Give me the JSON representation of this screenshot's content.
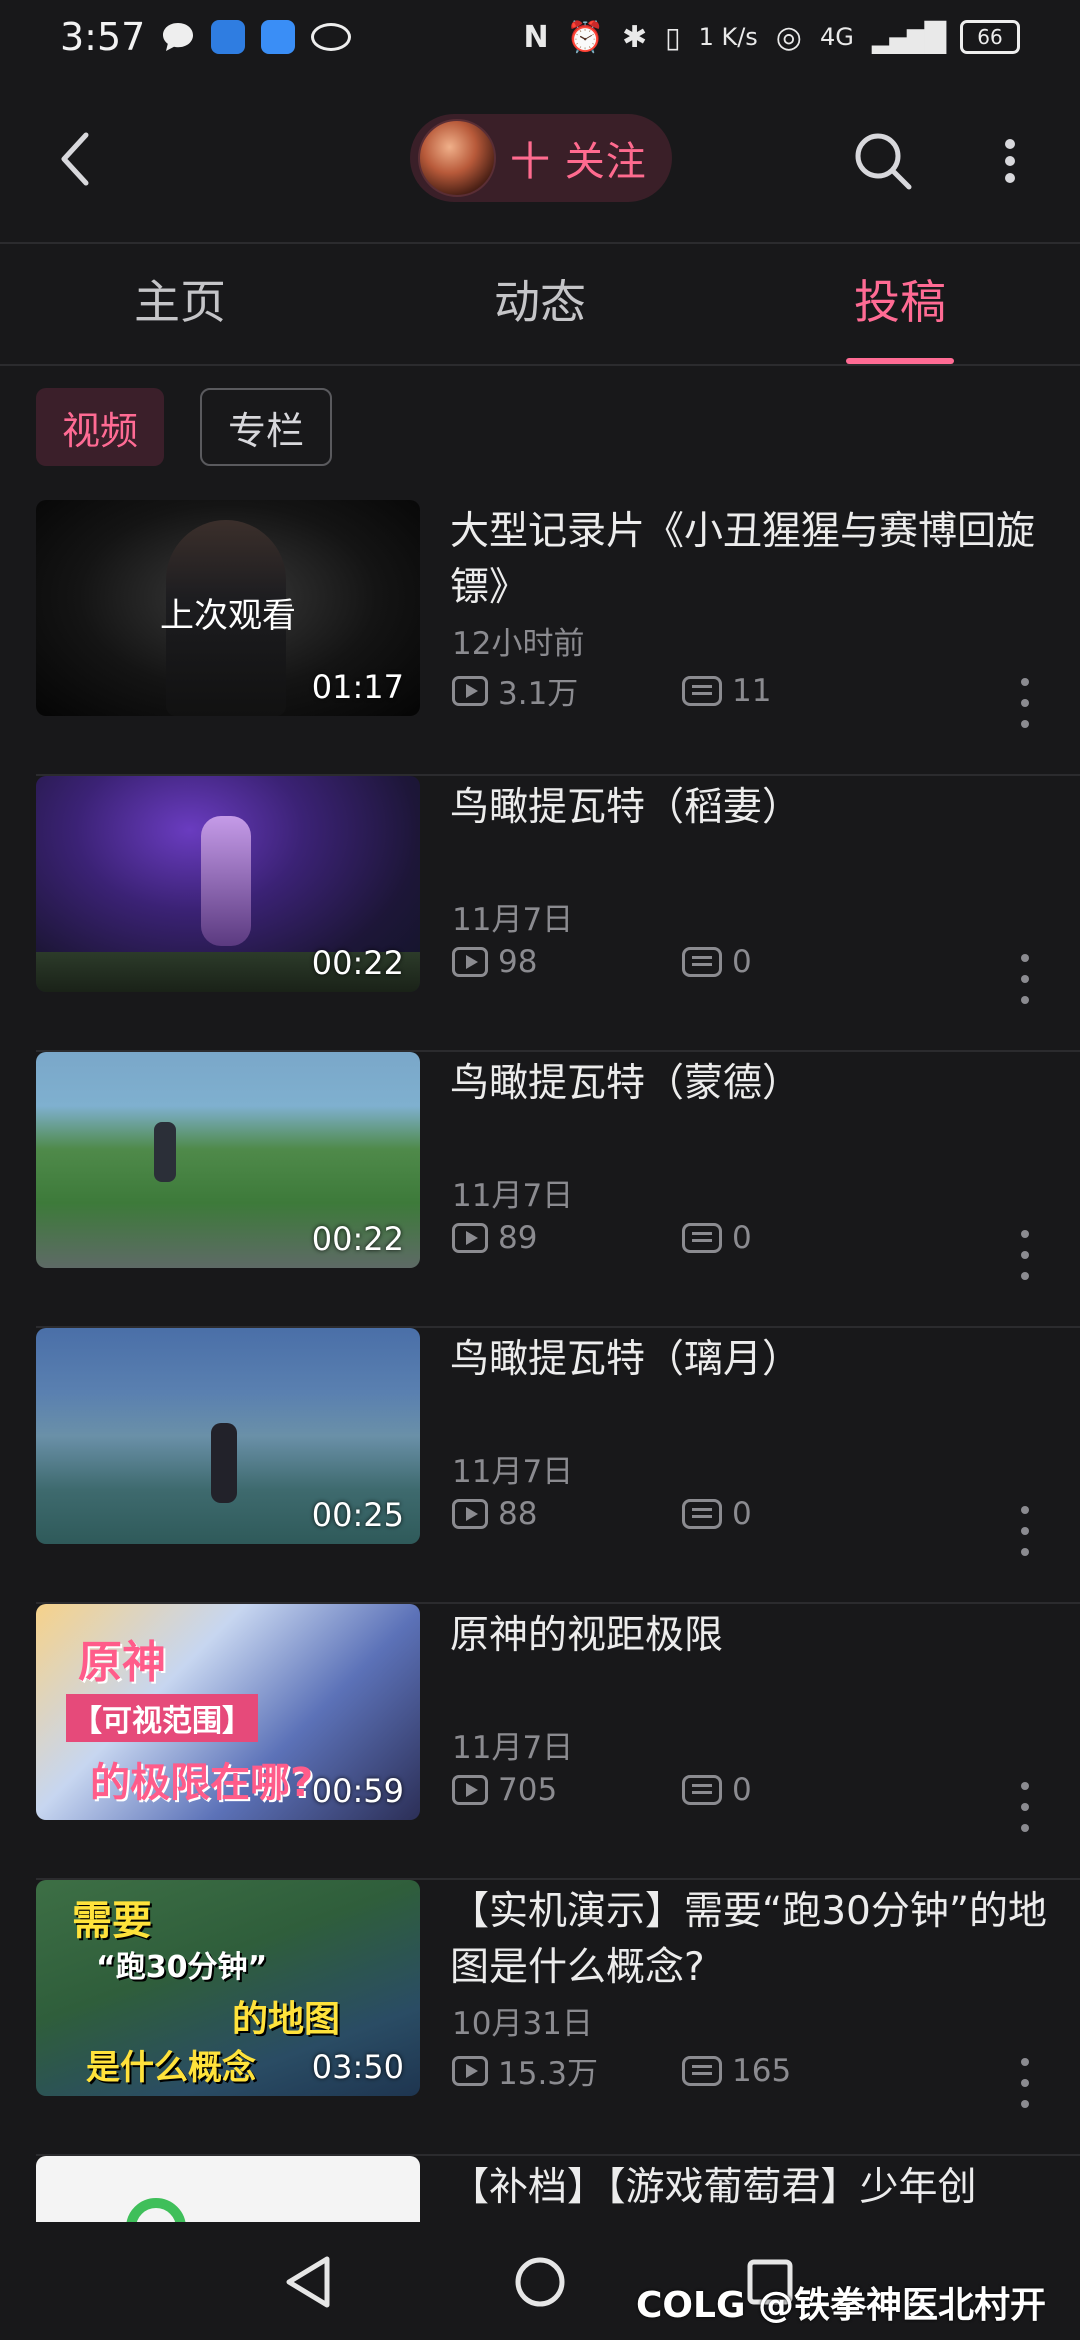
{
  "status_bar": {
    "time": "3:57",
    "net_speed": "1 K/s",
    "signal_label": "4G",
    "battery": "66"
  },
  "header": {
    "follow_label": "十 关注"
  },
  "tabs": [
    {
      "label": "主页",
      "active": false
    },
    {
      "label": "动态",
      "active": false
    },
    {
      "label": "投稿",
      "active": true
    }
  ],
  "filters": [
    {
      "label": "视频",
      "active": true
    },
    {
      "label": "专栏",
      "active": false
    }
  ],
  "videos": [
    {
      "title": "大型记录片《小丑猩猩与赛博回旋镖》",
      "date": "12小时前",
      "views": "3.1万",
      "comments": "11",
      "duration": "01:17",
      "overlay": "上次观看"
    },
    {
      "title": "鸟瞰提瓦特（稻妻）",
      "date": "11月7日",
      "views": "98",
      "comments": "0",
      "duration": "00:22"
    },
    {
      "title": "鸟瞰提瓦特（蒙德）",
      "date": "11月7日",
      "views": "89",
      "comments": "0",
      "duration": "00:22"
    },
    {
      "title": "鸟瞰提瓦特（璃月）",
      "date": "11月7日",
      "views": "88",
      "comments": "0",
      "duration": "00:25"
    },
    {
      "title": "原神的视距极限",
      "date": "11月7日",
      "views": "705",
      "comments": "0",
      "duration": "00:59",
      "caption_lines": [
        "原神",
        "【可视范围】",
        "的极限在哪?"
      ]
    },
    {
      "title": "【实机演示】需要“跑30分钟”的地图是什么概念?",
      "date": "10月31日",
      "views": "15.3万",
      "comments": "165",
      "duration": "03:50",
      "caption_lines": [
        "需要",
        "“跑30分钟”",
        "的地图",
        "是什么概念"
      ]
    },
    {
      "title": "【补档】【游戏葡萄君】少年创"
    }
  ],
  "watermark": "COLG @铁拳神医北村开",
  "colors": {
    "accent": "#ff6b94",
    "background": "#18181a"
  }
}
